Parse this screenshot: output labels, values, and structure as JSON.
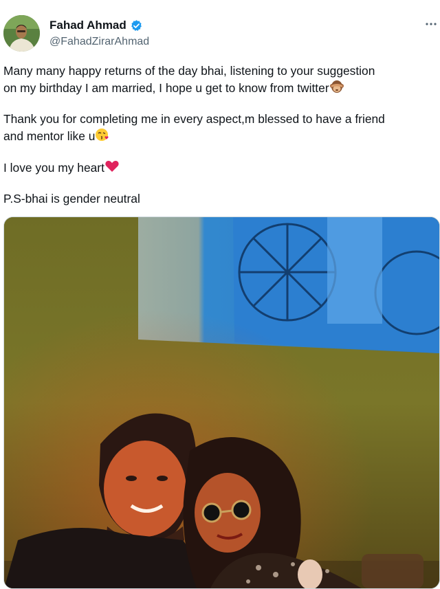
{
  "tweet": {
    "author": {
      "name": "Fahad Ahmad",
      "handle": "@FahadZirarAhmad",
      "avatar_icon": "profile-photo",
      "verified_icon": "verified-badge-icon",
      "verified_color": "#1d9bf0"
    },
    "more_icon": "more-options-icon",
    "paragraphs": {
      "p1_line1": "Many many happy returns of the day bhai, listening to your suggestion",
      "p1_line2": "on my birthday I am married, I hope u get to know from twitter",
      "p1_emoji": "see-no-evil-monkey-emoji",
      "p2_line1": "Thank you for completing me in every aspect,m blessed to have a friend",
      "p2_line2": "and mentor like u",
      "p2_emoji": "face-blowing-kiss-emoji",
      "p3_line1": "I love you my heart",
      "p3_emoji": "red-heart-emoji",
      "p4_line1": "P.S-bhai is gender neutral"
    },
    "media": {
      "kind": "photo",
      "image_icon": "couple-photo"
    }
  },
  "colors": {
    "text": "#0f1419",
    "secondary": "#536471",
    "accent": "#1d9bf0"
  }
}
